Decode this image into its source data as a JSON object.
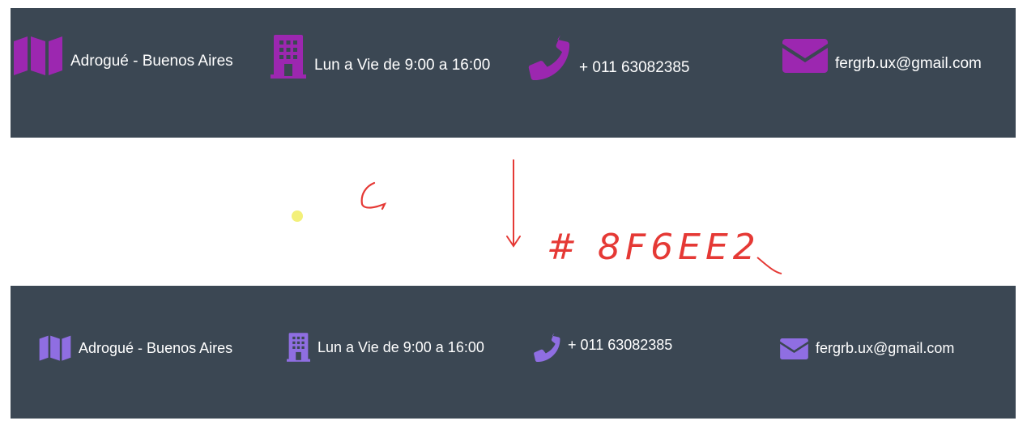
{
  "colors": {
    "bar_bg": "#3b4753",
    "text": "#ffffff",
    "icon_old": "#9c27b0",
    "icon_new": "#8f6ee2",
    "annotation": "#e53935",
    "cursor_dot": "#f3f07a"
  },
  "top_bar": {
    "location": {
      "icon": "map-icon",
      "text": "Adrogué - Buenos Aires"
    },
    "hours": {
      "icon": "building-icon",
      "text": "Lun a Vie de 9:00 a 16:00"
    },
    "phone": {
      "icon": "phone-icon",
      "text": "+ 011 63082385"
    },
    "email": {
      "icon": "envelope-icon",
      "text": "fergrb.ux@gmail.com"
    }
  },
  "annotation": {
    "handwritten_text": "# 8F6EE2"
  },
  "bottom_bar": {
    "location": {
      "icon": "map-icon",
      "text": "Adrogué - Buenos Aires"
    },
    "hours": {
      "icon": "building-icon",
      "text": "Lun a Vie de 9:00 a 16:00"
    },
    "phone": {
      "icon": "phone-icon",
      "text": "+ 011 63082385"
    },
    "email": {
      "icon": "envelope-icon",
      "text": "fergrb.ux@gmail.com"
    }
  }
}
